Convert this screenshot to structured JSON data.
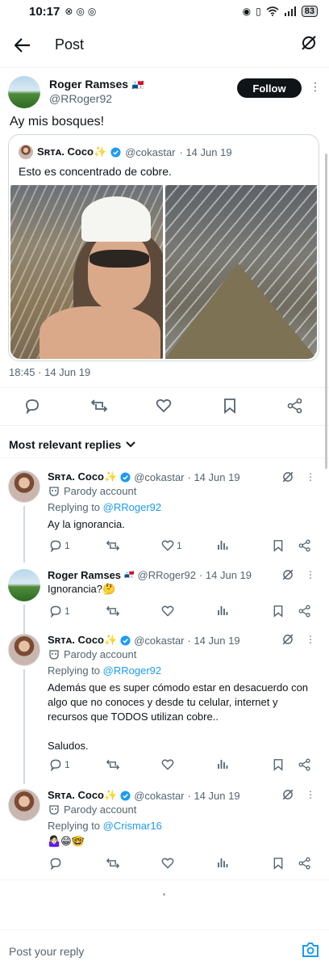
{
  "statusbar": {
    "time": "10:17",
    "battery": "83"
  },
  "topbar": {
    "title": "Post"
  },
  "post": {
    "author_name": "Roger Ramses",
    "author_flag": "🇵🇦",
    "author_handle": "@RRoger92",
    "follow_label": "Follow",
    "text": "Ay mis bosques!",
    "timestamp": "18:45 · 14 Jun 19"
  },
  "quote": {
    "author_name": "Sʀᴛᴀ. Coco✨",
    "author_handle": "@cokastar",
    "date": "· 14 Jun 19",
    "text": "Esto es concentrado de cobre."
  },
  "replies_header": {
    "label": "Most relevant replies"
  },
  "replies": [
    {
      "name": "Sʀᴛᴀ. Coco✨",
      "handle": "@cokastar",
      "date": "· 14 Jun 19",
      "parody": "Parody account",
      "replying_prefix": "Replying to",
      "replying_to": "@RRoger92",
      "body": "Ay la ignorancia.",
      "reply_count": "1",
      "like_count": "1"
    },
    {
      "name": "Roger Ramses",
      "flag": "🇵🇦",
      "handle": "@RRoger92",
      "date": "· 14 Jun 19",
      "body": "Ignorancia?🤔",
      "reply_count": "1"
    },
    {
      "name": "Sʀᴛᴀ. Coco✨",
      "handle": "@cokastar",
      "date": "· 14 Jun 19",
      "parody": "Parody account",
      "replying_prefix": "Replying to",
      "replying_to": "@RRoger92",
      "body": "Además que es super cómodo estar en desacuerdo con algo que no conoces y desde tu celular, internet y recursos que TODOS utilizan cobre..\n\nSaludos.",
      "reply_count": "1"
    },
    {
      "name": "Sʀᴛᴀ. Coco✨",
      "handle": "@cokastar",
      "date": "· 14 Jun 19",
      "parody": "Parody account",
      "replying_prefix": "Replying to",
      "replying_to": "@Crismar16",
      "body": "🤷🏻‍♀️😁🤓"
    }
  ],
  "composer": {
    "placeholder": "Post your reply"
  },
  "colors": {
    "accent": "#1d9bf0",
    "text": "#0f1419",
    "muted": "#536471",
    "border": "#eff3f4"
  }
}
